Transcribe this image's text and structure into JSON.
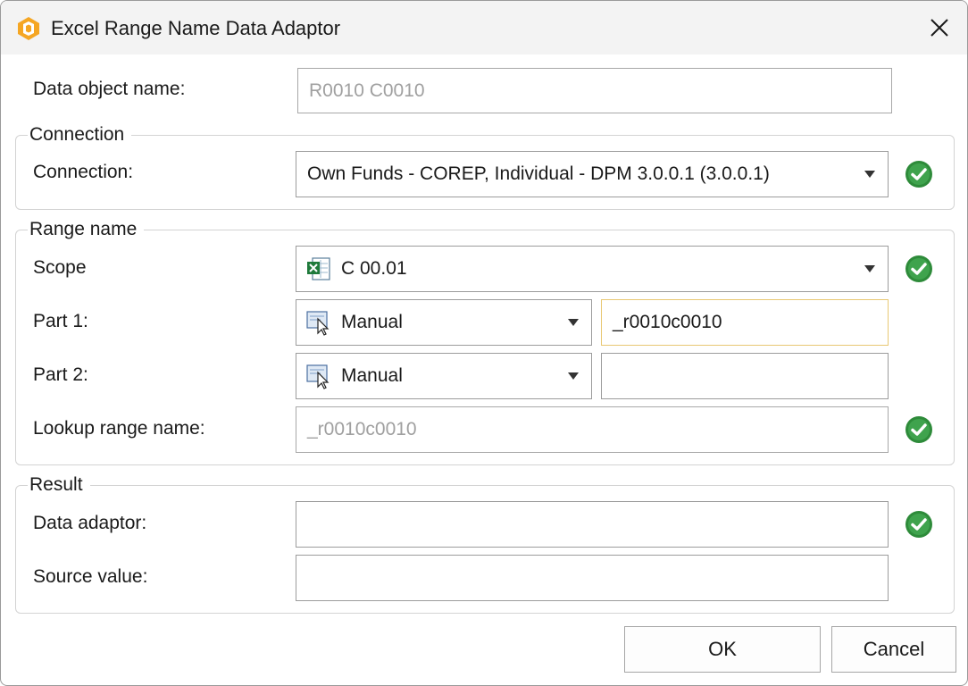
{
  "window": {
    "title": "Excel Range Name Data Adaptor"
  },
  "data_object": {
    "label": "Data object name:",
    "value": "R0010 C0010"
  },
  "connection_group": {
    "title": "Connection",
    "label": "Connection:",
    "value": "Own Funds - COREP, Individual - DPM 3.0.0.1 (3.0.0.1)"
  },
  "range_group": {
    "title": "Range name",
    "scope_label": "Scope",
    "scope_value": "C 00.01",
    "part1_label": "Part 1:",
    "part1_mode": "Manual",
    "part1_value": "_r0010c0010",
    "part2_label": "Part 2:",
    "part2_mode": "Manual",
    "part2_value": "",
    "lookup_label": "Lookup range name:",
    "lookup_value": "_r0010c0010"
  },
  "result_group": {
    "title": "Result",
    "adaptor_label": "Data adaptor:",
    "adaptor_value": "",
    "source_label": "Source value:",
    "source_value": ""
  },
  "buttons": {
    "ok": "OK",
    "cancel": "Cancel"
  },
  "icons": {
    "app": "app-logo-icon",
    "close": "close-icon",
    "check": "check-circle-icon",
    "excel": "excel-sheet-icon",
    "manual": "manual-cursor-icon"
  },
  "colors": {
    "check_green": "#2e8b3a",
    "app_orange": "#f5a623",
    "focus_border": "#e8c873"
  }
}
